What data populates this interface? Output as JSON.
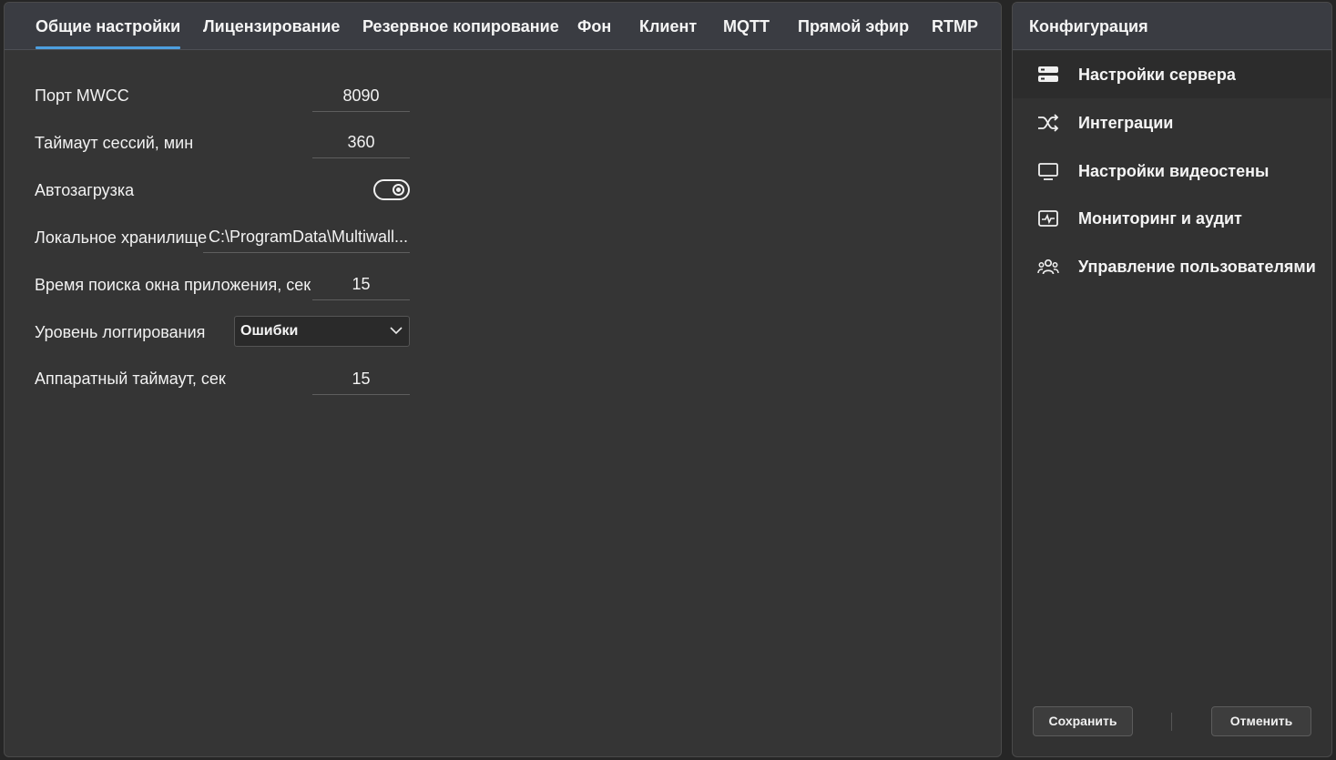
{
  "tabs": [
    {
      "label": "Общие настройки",
      "active": true
    },
    {
      "label": "Лицензирование"
    },
    {
      "label": "Резервное копирование"
    },
    {
      "label": "Фон"
    },
    {
      "label": "Клиент"
    },
    {
      "label": "MQTT"
    },
    {
      "label": "Прямой эфир"
    },
    {
      "label": "RTMP"
    }
  ],
  "settings": {
    "port": {
      "label": "Порт MWCC",
      "value": "8090"
    },
    "session_timeout": {
      "label": "Таймаут сессий, мин",
      "value": "360"
    },
    "autoload": {
      "label": "Автозагрузка",
      "enabled": true
    },
    "local_storage": {
      "label": "Локальное хранилище",
      "value": "C:\\ProgramData\\Multiwall..."
    },
    "window_search": {
      "label": "Время поиска окна приложения, сек",
      "value": "15"
    },
    "log_level": {
      "label": "Уровень логгирования",
      "value": "Ошибки"
    },
    "hardware_timeout": {
      "label": "Аппаратный таймаут, сек",
      "value": "15"
    }
  },
  "sidebar": {
    "title": "Конфигурация",
    "items": [
      {
        "label": "Настройки сервера",
        "icon": "server-icon",
        "active": true
      },
      {
        "label": "Интеграции",
        "icon": "shuffle-icon"
      },
      {
        "label": "Настройки видеостены",
        "icon": "monitor-icon"
      },
      {
        "label": "Мониторинг и аудит",
        "icon": "activity-icon"
      },
      {
        "label": "Управление пользователями",
        "icon": "users-icon"
      }
    ]
  },
  "buttons": {
    "save": "Сохранить",
    "cancel": "Отменить"
  },
  "colors": {
    "accent": "#4d9fe0",
    "panel": "#353535",
    "header": "#3a3c42"
  }
}
